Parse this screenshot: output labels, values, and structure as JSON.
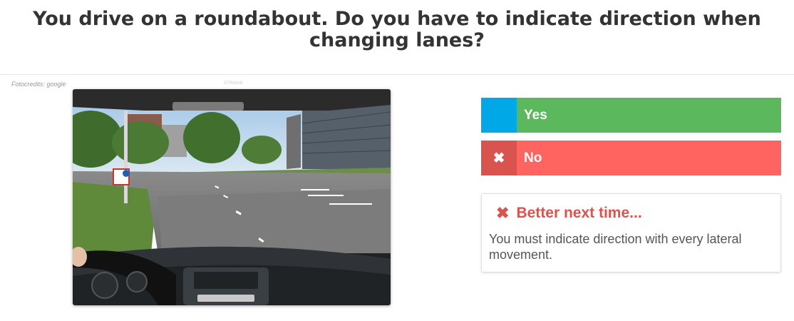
{
  "question": "You drive on a roundabout. Do you have to indicate direction when changing lanes?",
  "photo": {
    "credits": "Fotocredits: google",
    "watermark": "STRIGAS"
  },
  "answers": [
    {
      "label": "Yes",
      "state": "correct-answer",
      "icon": ""
    },
    {
      "label": "No",
      "state": "selected-wrong",
      "icon": "✖"
    }
  ],
  "feedback": {
    "icon": "✖",
    "title": "Better next time...",
    "text": "You must indicate direction with every lateral movement."
  },
  "colors": {
    "yes_bg": "#5cb85c",
    "yes_tab": "#00a8e8",
    "no_bg": "#ff6460",
    "no_tab": "#d9534f",
    "feedback_title": "#d9534f"
  }
}
